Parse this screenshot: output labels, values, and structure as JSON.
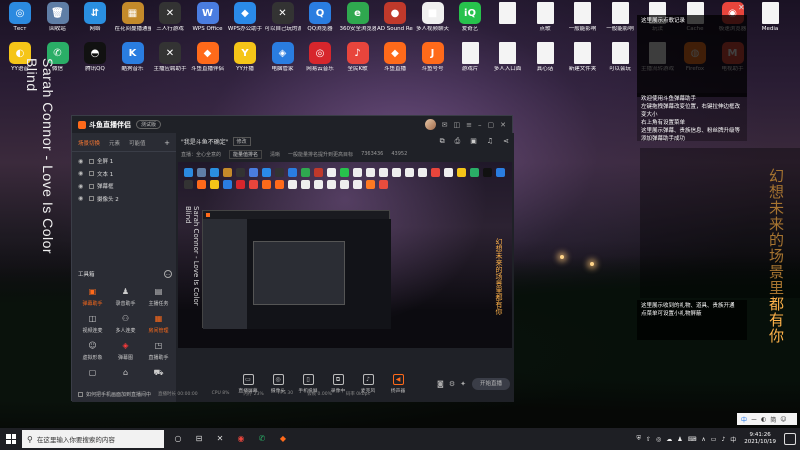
{
  "desktop": {
    "icons_row1": [
      {
        "label": "Тест",
        "glyph": "◎",
        "color": "#2b8ae0"
      },
      {
        "label": "回收站",
        "glyph": "🗑",
        "color": "#5f7ea6"
      },
      {
        "label": "网络",
        "glyph": "⇵",
        "color": "#2a8fe0"
      },
      {
        "label": "在花间蔓播通量调整",
        "glyph": "▦",
        "color": "#c48a2a"
      },
      {
        "label": "三人行游戏",
        "glyph": "✕",
        "color": "#333"
      },
      {
        "label": "WPS Office",
        "glyph": "W",
        "color": "#4a7de0"
      },
      {
        "label": "WPS办公助手",
        "glyph": "◆",
        "color": "#2a8ae8"
      },
      {
        "label": "可以自己玩的游戏",
        "glyph": "✕",
        "color": "#333"
      },
      {
        "label": "QQ浏览器",
        "glyph": "Q",
        "color": "#2a7de0"
      },
      {
        "label": "360安全浏览器",
        "glyph": "e",
        "color": "#2fa84f"
      },
      {
        "label": "AD Sound Recorder",
        "glyph": "●",
        "color": "#c0392b"
      },
      {
        "label": "多人视频聊天",
        "glyph": "■",
        "color": "#f0f0f0"
      },
      {
        "label": "爱奇艺",
        "glyph": "iQ",
        "color": "#27c24c"
      },
      {
        "label": "",
        "glyph": "",
        "color": "file"
      },
      {
        "label": "点歌",
        "glyph": "",
        "color": "file"
      },
      {
        "label": "一般能影响",
        "glyph": "",
        "color": "file"
      },
      {
        "label": "一般能影响",
        "glyph": "",
        "color": "file"
      },
      {
        "label": "玩法",
        "glyph": "",
        "color": "file"
      },
      {
        "label": "Cache",
        "glyph": "",
        "color": "file"
      },
      {
        "label": "极速浏览器",
        "glyph": "◉",
        "color": "#e8453c"
      },
      {
        "label": "Media",
        "glyph": "",
        "color": "file"
      }
    ],
    "icons_row2": [
      {
        "label": "YY语音",
        "glyph": "◐",
        "color": "#f5c518"
      },
      {
        "label": "微信",
        "glyph": "✆",
        "color": "#2aae67"
      },
      {
        "label": "腾讯QQ",
        "glyph": "◓",
        "color": "#111"
      },
      {
        "label": "酷狗音乐",
        "glyph": "K",
        "color": "#2a7de0"
      },
      {
        "label": "主播应聘助手",
        "glyph": "✕",
        "color": "#333"
      },
      {
        "label": "斗鱼直播伴侣",
        "glyph": "◆",
        "color": "#ff6a1a"
      },
      {
        "label": "YY开播",
        "glyph": "Y",
        "color": "#f5c518"
      },
      {
        "label": "电脑管家",
        "glyph": "◈",
        "color": "#2a7de0"
      },
      {
        "label": "网易云音乐",
        "glyph": "◎",
        "color": "#d7262c"
      },
      {
        "label": "全民K歌",
        "glyph": "♪",
        "color": "#e8453c"
      },
      {
        "label": "斗鱼直播",
        "glyph": "◆",
        "color": "#ff6a1a"
      },
      {
        "label": "斗鱼号号",
        "glyph": "J",
        "color": "#ff6a1a"
      },
      {
        "label": "游戏片",
        "glyph": "",
        "color": "file"
      },
      {
        "label": "多人入口面",
        "glyph": "",
        "color": "file"
      },
      {
        "label": "真心话",
        "glyph": "",
        "color": "file"
      },
      {
        "label": "新建文件夹",
        "glyph": "",
        "color": "file"
      },
      {
        "label": "可以会玩",
        "glyph": "",
        "color": "file"
      },
      {
        "label": "主播流转游戏",
        "glyph": "",
        "color": "file"
      },
      {
        "label": "Firefox",
        "glyph": "◍",
        "color": "#ff7a22"
      },
      {
        "label": "电视助手",
        "glyph": "M",
        "color": "#e84c3d"
      }
    ],
    "lyric_en": "Sarah Connor - Love Is Color Blind",
    "lyric_cn": "幻想未来的场景里都有你"
  },
  "right_panels": {
    "top_text": "这里展示点歌记录",
    "mid_lines": [
      "欢迎使用斗鱼弹幕助手",
      "左键拖拽弹幕改变位置，右键拉伸边框改变大小",
      "右上角有设置菜单",
      "这里展示弹幕、贵族信息、粉丝牌升级等",
      "添加弹幕助手成功"
    ],
    "bot_lines": [
      "这里展示收到的礼物、道具、贵族开通",
      "点菜单可设置小礼物屏蔽"
    ]
  },
  "app": {
    "brand": "斗鱼直播伴侣",
    "version_badge": "测试版",
    "side_tabs": [
      "场景切换",
      "元素",
      "可能值"
    ],
    "active_side_tab": 0,
    "scenes": [
      {
        "name": "全屏 1"
      },
      {
        "name": "文本 1"
      },
      {
        "name": "弹幕框"
      },
      {
        "name": "摄像头 2"
      }
    ],
    "tools_title": "工具箱",
    "tools": [
      {
        "label": "弹幕助手",
        "glyph": "▣",
        "style": "orange"
      },
      {
        "label": "录音助手",
        "glyph": "♟",
        "style": "grey"
      },
      {
        "label": "主播任务",
        "glyph": "▤",
        "style": "grey"
      },
      {
        "label": "视频连麦",
        "glyph": "◫",
        "style": "grey"
      },
      {
        "label": "多人连麦",
        "glyph": "⚇",
        "style": "grey"
      },
      {
        "label": "房间管理",
        "glyph": "▦",
        "style": "orange"
      },
      {
        "label": "虚拟形象",
        "glyph": "☺",
        "style": "grey"
      },
      {
        "label": "弹幕图",
        "glyph": "◈",
        "style": "red"
      },
      {
        "label": "直播助手",
        "glyph": "◳",
        "style": "grey"
      },
      {
        "label": "",
        "glyph": "▢",
        "style": "grey"
      },
      {
        "label": "",
        "glyph": "⌂",
        "style": "grey"
      },
      {
        "label": "",
        "glyph": "⛟",
        "style": "grey"
      }
    ],
    "tip": "如何把手机画面加到直播间中",
    "room": {
      "title": "\"我是斗鱼不确定\"",
      "edit": "修改",
      "meta": [
        "直播：全心全意的",
        "能量值排名",
        "清晰",
        "一般能量排名提升到更高目标",
        "7363436",
        "43952"
      ]
    },
    "controls": [
      {
        "label": "直播屏幕",
        "glyph": "▭"
      },
      {
        "label": "摄像头",
        "glyph": "◎"
      },
      {
        "label": "手机投屏",
        "glyph": "▯"
      },
      {
        "label": "录像中",
        "glyph": "⧉"
      },
      {
        "label": "麦克风",
        "glyph": "♪"
      },
      {
        "label": "扬声器",
        "glyph": "◀",
        "style": "orange"
      }
    ],
    "go_live": "开始直播",
    "stats": [
      "直播时长 00:00:00",
      "CPU 8%",
      "内存 23%",
      "FPS 30",
      "丢帧 0.00%",
      "码率 0kbps"
    ]
  },
  "taskbar": {
    "search_placeholder": "在这里输入你要搜索的内容",
    "apps": [
      {
        "glyph": "○",
        "color": "#ddd"
      },
      {
        "glyph": "⊟",
        "color": "#ddd"
      },
      {
        "glyph": "✕",
        "color": "#ddd"
      },
      {
        "glyph": "◉",
        "color": "#e8453c"
      },
      {
        "glyph": "✆",
        "color": "#2aae67"
      },
      {
        "glyph": "◆",
        "color": "#ff6a1a"
      }
    ],
    "tray_icons": [
      "⛨",
      "⇧",
      "◎",
      "☁",
      "♟",
      "⌨",
      "∧",
      "▭",
      "♪",
      "中"
    ],
    "time": "9:41:26",
    "date": "2021/10/19",
    "ime": [
      "中",
      "ー",
      "◐",
      "简",
      "☺"
    ]
  },
  "icons": {
    "start": "windows-logo",
    "search": "magnifier"
  }
}
